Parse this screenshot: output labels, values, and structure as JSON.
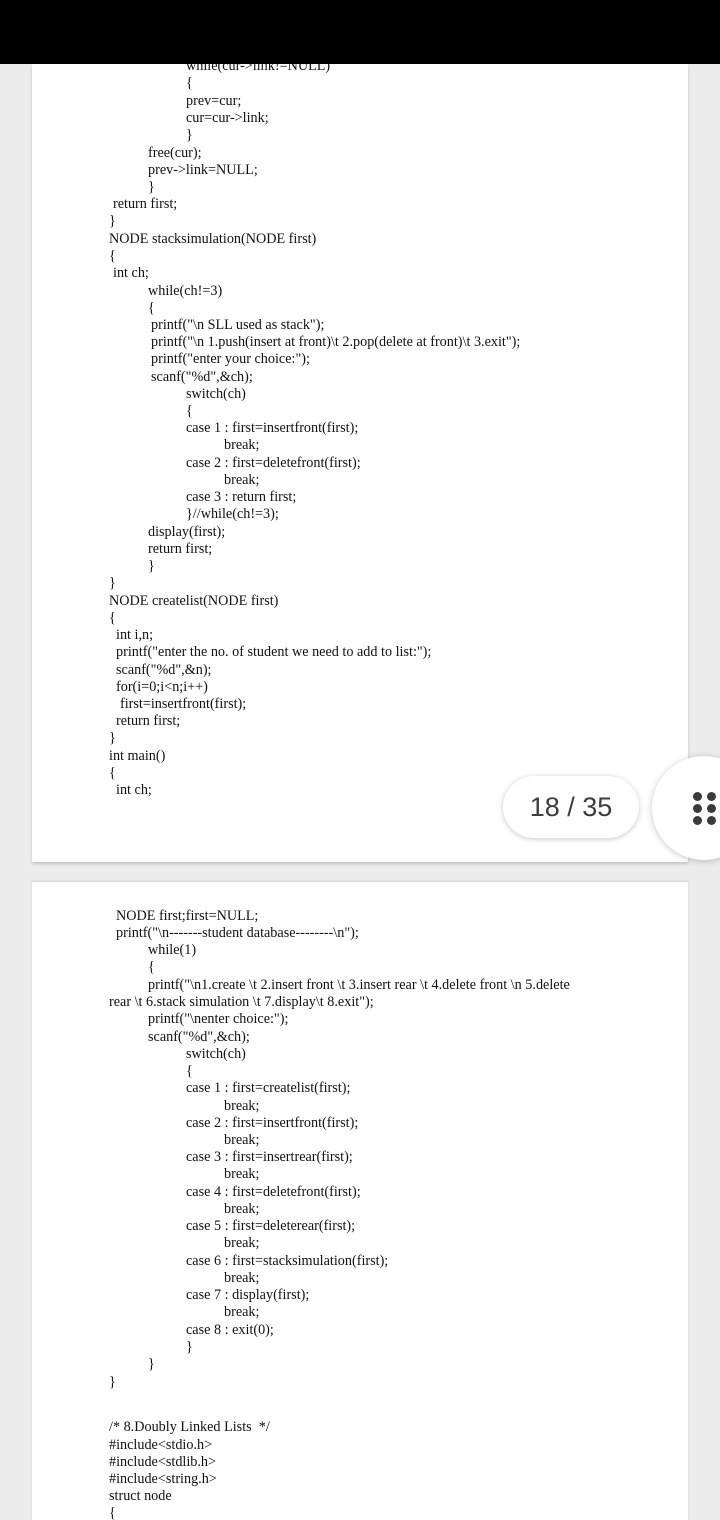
{
  "page_indicator": {
    "current": "18",
    "total": "35",
    "label": "18 / 35"
  },
  "colors": {
    "status_bar": "#000000",
    "page": "#ffffff",
    "background": "#ececec",
    "text": "#111111"
  },
  "icons": {
    "menu": "grid-dots-icon"
  },
  "page_top_lines": [
    "while(cur->link!=NULL)",
    "{",
    "prev=cur;",
    "cur=cur->link;",
    "}",
    "free(cur);",
    "prev->link=NULL;",
    "}",
    "return first;",
    "}",
    "NODE stacksimulation(NODE first)",
    "{",
    "int ch;",
    "while(ch!=3)",
    "{",
    "printf(\"\\n SLL used as stack\");",
    "printf(\"\\n 1.push(insert at front)\\t 2.pop(delete at front)\\t 3.exit\");",
    "printf(\"enter your choice:\");",
    "scanf(\"%d\",&ch);",
    "switch(ch)",
    "{",
    "case 1 : first=insertfront(first);",
    "break;",
    "case 2 : first=deletefront(first);",
    "break;",
    "case 3 : return first;",
    "}//while(ch!=3);",
    "display(first);",
    "return first;",
    "}",
    "}",
    "NODE createlist(NODE first)",
    "{",
    "int i,n;",
    "printf(\"enter the no. of student we need to add to list:\");",
    "scanf(\"%d\",&n);",
    "for(i=0;i<n;i++)",
    "first=insertfront(first);",
    "return first;",
    "}",
    "int main()",
    "{",
    "int ch;"
  ],
  "page_bottom_lines": [
    "NODE first;first=NULL;",
    "printf(\"\\n-------student database--------\\n\");",
    "while(1)",
    "{",
    "printf(\"\\n1.create \\t 2.insert front \\t 3.insert rear \\t 4.delete front \\n 5.delete",
    "rear \\t 6.stack simulation \\t 7.display\\t 8.exit\");",
    "printf(\"\\nenter choice:\");",
    "scanf(\"%d\",&ch);",
    "switch(ch)",
    "{",
    "case 1 : first=createlist(first);",
    "break;",
    "case 2 : first=insertfront(first);",
    "break;",
    "case 3 : first=insertrear(first);",
    "break;",
    "case 4 : first=deletefront(first);",
    "break;",
    "case 5 : first=deleterear(first);",
    "break;",
    "case 6 : first=stacksimulation(first);",
    "break;",
    "case 7 : display(first);",
    "break;",
    "case 8 : exit(0);",
    "}",
    "}",
    "}",
    "/* 8.Doubly Linked Lists  */",
    "#include<stdio.h>",
    "#include<stdlib.h>",
    "#include<string.h>",
    "struct node",
    "{"
  ]
}
